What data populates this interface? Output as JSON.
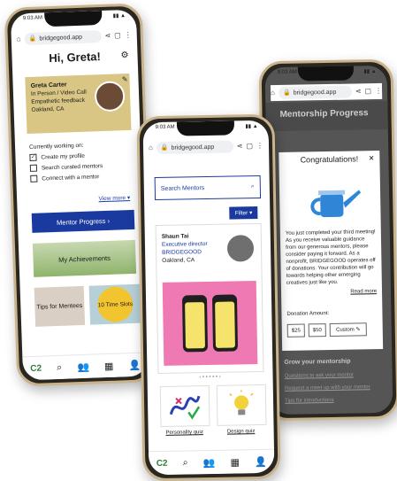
{
  "browser": {
    "url": "bridgegood.app",
    "time": "9:03 AM"
  },
  "left": {
    "greeting": "Hi, Greta!",
    "profile": {
      "name": "Greta Carter",
      "line1": "In Person / Video Call",
      "line2": "Empathetic feedback",
      "location": "Oakland, CA"
    },
    "working_title": "Currently working on:",
    "tasks": [
      {
        "label": "Create my profile",
        "checked": true
      },
      {
        "label": "Search curated mentors",
        "checked": false
      },
      {
        "label": "Connect with a mentor",
        "checked": false
      }
    ],
    "view_more": "View more ▾",
    "progress_button": "Mentor Progress  ›",
    "achievements": "My Achievements",
    "tips": "Tips for Mentees",
    "time_slots": "10 Time Slots"
  },
  "middle": {
    "search_placeholder": "Search Mentors",
    "filter": "Filter ▾",
    "mentor": {
      "name": "Shaun Tai",
      "role": "Executive director",
      "org": "BRIDGEGOOD",
      "location": "Oakland, CA"
    },
    "quiz1": "Personality quiz",
    "quiz2": "Design quiz"
  },
  "right": {
    "page_title": "Mentorship Progress",
    "modal_title": "Congratulations!",
    "modal_text": "You just completed your third meeting! As you receive valuable guidance from our generous mentors, please consider paying it forward. As a nonprofit, BRIDGEGOOD operates off of donations. Your contribution will go towards helping other emerging creatives just like you.",
    "read_more": "Read more",
    "donation_label": "Donation Amount:",
    "amounts": [
      "$25",
      "$50",
      "Custom"
    ],
    "grow": "Grow your mentorship",
    "links": [
      "Questions to ask your mentor",
      "Request a meet up with your mentor",
      "Tips for introductions"
    ]
  },
  "colors": {
    "brand_blue": "#1a3aa0",
    "card_gold": "#d9c685",
    "pink": "#ef79b3"
  }
}
